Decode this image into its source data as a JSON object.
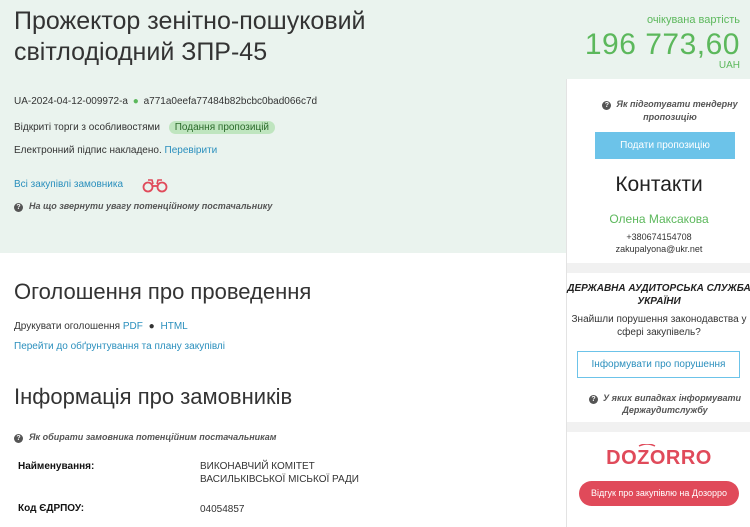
{
  "tender": {
    "title": "Прожектор зенітно-пошуковий світлодіодний ЗПР-45",
    "expected_value_label": "очікувана вартість",
    "expected_value": "196 773,60",
    "currency": "UAH",
    "id": "UA-2024-04-12-009972-a",
    "hash": "a771a0eefa77484b82bcbc0bad066c7d",
    "procedure_type": "Відкриті торги з особливостями",
    "status_badge": "Подання пропозицій",
    "signature_text": "Електронний підпис накладено.",
    "signature_link": "Перевірити",
    "all_procurements_link": "Всі закупівлі замовника",
    "supplier_hint": "На що звернути увагу потенційному постачальнику"
  },
  "announcement": {
    "heading": "Оголошення про проведення",
    "print_label": "Друкувати оголошення",
    "pdf_link": "PDF",
    "html_link": "HTML",
    "plan_link": "Перейти до обґрунтування та плану закупівлі"
  },
  "customers": {
    "heading": "Інформація про замовників",
    "hint": "Як обирати замовника потенційним постачальникам",
    "rows": [
      {
        "label": "Найменування:",
        "value": "ВИКОНАВЧИЙ КОМІТЕТ ВАСИЛЬКІВСЬКОЇ МІСЬКОЇ РАДИ"
      },
      {
        "label": "Код ЄДРПОУ:",
        "value": "04054857"
      }
    ]
  },
  "sidebar": {
    "prepare_hint": "Як підготувати тендерну пропозицію",
    "submit_button": "Подати пропозицію",
    "contacts_title": "Контакти",
    "contact_name": "Олена Максакова",
    "contact_phone": "+380674154708",
    "contact_email": "zakupalyona@ukr.net",
    "audit_title": "ДЕРЖАВНА АУДИТОРСЬКА СЛУЖБА УКРАЇНИ",
    "audit_text": "Знайшли порушення законодавства у сфері закупівель?",
    "report_button": "Інформувати про порушення",
    "audit_hint": "У яких випадках інформувати Держаудитслужбу",
    "dozorro_logo": "DOZORRO",
    "review_button": "Відгук про закупівлю на Дозорро"
  },
  "colors": {
    "accent_green": "#5cb85c",
    "link_blue": "#2a8fbd",
    "button_blue": "#6cc3e9",
    "dozorro_red": "#e04a5a",
    "hero_bg": "#eaf3ee"
  },
  "icons": {
    "question": "question-circle-icon",
    "binoculars": "binoculars-icon"
  }
}
